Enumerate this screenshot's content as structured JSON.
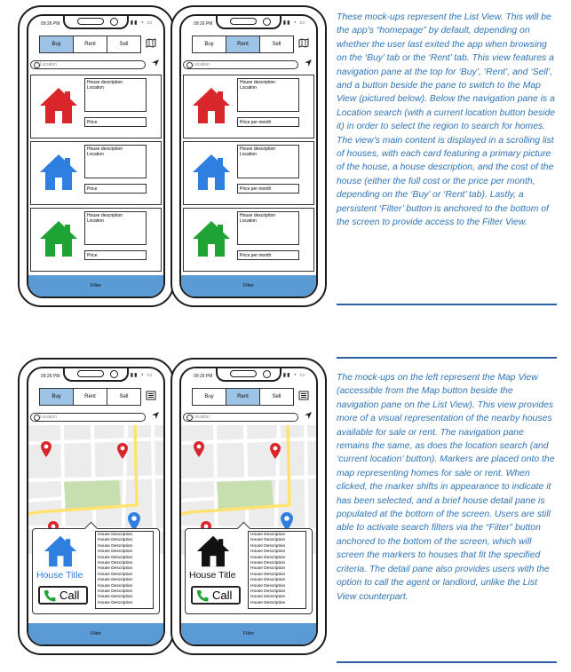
{
  "status_time": "09:26 PM",
  "nav_labels": {
    "buy": "Buy",
    "rent": "Rent",
    "sell": "Sell"
  },
  "search_placeholder": "Location",
  "card_desc_line1": "House description",
  "card_desc_line2": "Location",
  "price_label_buy": "Price",
  "price_label_rent": "Price per month",
  "filter_label": "Filter",
  "detail": {
    "house_title": "House Title",
    "call_label": "Call",
    "description_line": "House Description",
    "description_lines": [
      "House Description",
      "House Description",
      "House Description",
      "House Description",
      "House Description",
      "House Description",
      "House Description",
      "House Description",
      "House Description",
      "House Description",
      "House Description",
      "House Description",
      "House Description"
    ]
  },
  "text_list_view": "These mock-ups represent the List View. This will be the app’s “homepage” by default, depending on whether the user last exited the app when browsing on the ‘Buy’ tab or the ‘Rent’ tab. This view features a navigation pane at the top for ‘Buy’, ‘Rent’, and ‘Sell’, and a button beside the pane to switch to the Map View (pictured below). Below the navigation pane is a Location search (with a current location button beside it) in order to select the region to search for homes. The view’s main content is displayed in a scrolling list of houses, with each card featuring a primary picture of the house, a house description, and the cost of the house (either the full cost or the price per month, depending on the ‘Buy’ or ‘Rent’ tab). Lastly, a persistent ‘Filter’ button is anchored to the bottom of the screen to provide access to the Filter View.",
  "text_map_view": "The mock-ups on the left represent the Map View (accessible from the Map button beside the navigation pane on the List View). This view provides more of a visual representation of the nearby houses available for sale or rent. The navigation pane remains the same, as does the location search (and ‘current location’ button). Markers are placed onto the map representing homes for sale or rent. When clicked, the marker shifts in appearance to indicate it has been selected, and a brief house detail pane is populated at the bottom of the screen. Users are still able to activate search filters via the “Filter” button anchored to the bottom of the screen, which will screen the markers to houses that fit the specified criteria. The detail pane also provides users with the option to call the agent or landlord, unlike the List View counterpart.",
  "colors": {
    "red_house": "#d9262a",
    "blue_house": "#2e7fe0",
    "green_house": "#1ea334",
    "selected_tab": "#9dc3e6",
    "filter_bar": "#5b9bd5",
    "text_blue": "#2e74b5"
  }
}
